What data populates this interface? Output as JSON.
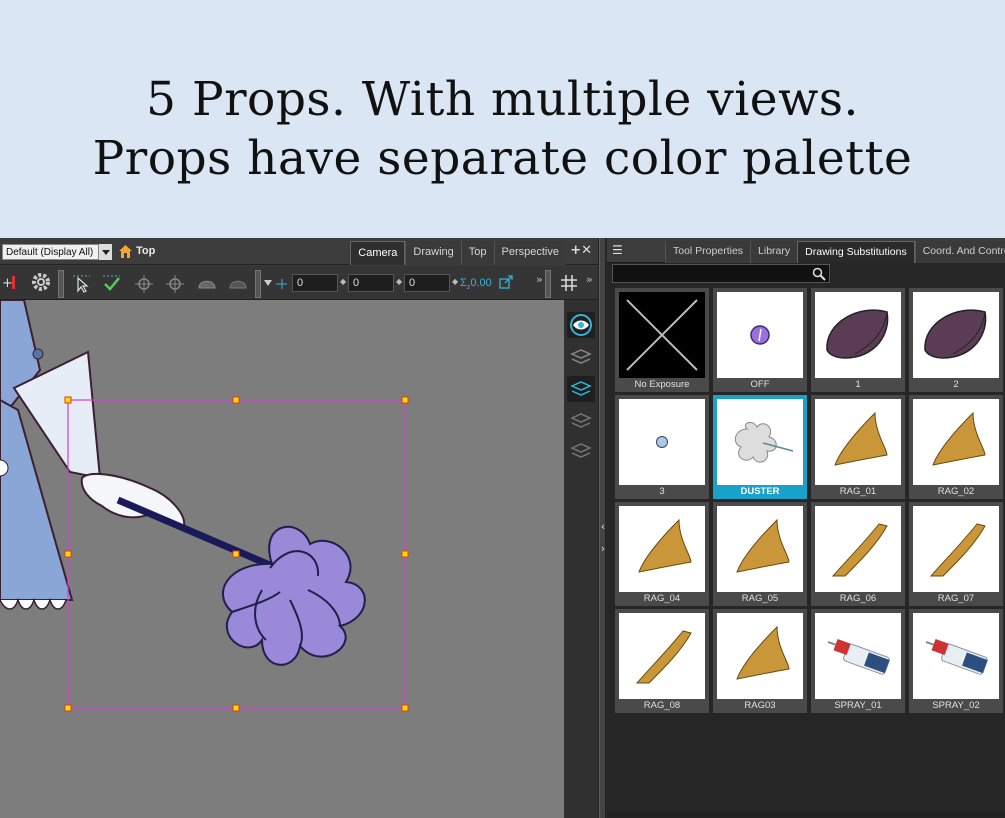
{
  "caption": {
    "line1": "5 Props. With multiple views.",
    "line2": "Props have separate color palette"
  },
  "viewer": {
    "display_dropdown": "Default (Display All)",
    "view_name": "Top",
    "tabs": [
      "Camera",
      "Drawing",
      "Top",
      "Perspective"
    ],
    "active_tab": "Camera",
    "fields": [
      "0",
      "0",
      "0"
    ],
    "z_value": "0.00"
  },
  "panel": {
    "tabs": [
      "Tool Properties",
      "Library",
      "Drawing Substitutions",
      "Coord. And Control"
    ],
    "active_tab": "Drawing Substitutions",
    "items": [
      {
        "label": "No Exposure",
        "thumb": "x-icon"
      },
      {
        "label": "OFF",
        "thumb": "dot-purple"
      },
      {
        "label": "1",
        "thumb": "bowl-purple"
      },
      {
        "label": "2",
        "thumb": "bowl-purple"
      },
      {
        "label": "3",
        "thumb": "dot-blue"
      },
      {
        "label": "DUSTER",
        "thumb": "duster"
      },
      {
        "label": "RAG_01",
        "thumb": "rag"
      },
      {
        "label": "RAG_02",
        "thumb": "rag"
      },
      {
        "label": "RAG_04",
        "thumb": "rag"
      },
      {
        "label": "RAG_05",
        "thumb": "rag"
      },
      {
        "label": "RAG_06",
        "thumb": "rag-thin"
      },
      {
        "label": "RAG_07",
        "thumb": "rag-thin"
      },
      {
        "label": "RAG_08",
        "thumb": "rag-thin"
      },
      {
        "label": "RAG03",
        "thumb": "rag"
      },
      {
        "label": "SPRAY_01",
        "thumb": "spray"
      },
      {
        "label": "SPRAY_02",
        "thumb": "spray"
      }
    ],
    "selected": "DUSTER"
  },
  "colors": {
    "caption_bg": "#dae6f3",
    "selection_accent": "#19a1c9",
    "bounding_box": "#d43fd4",
    "prop_purple": "#9a88d9",
    "rag_ochre": "#c9973a"
  }
}
